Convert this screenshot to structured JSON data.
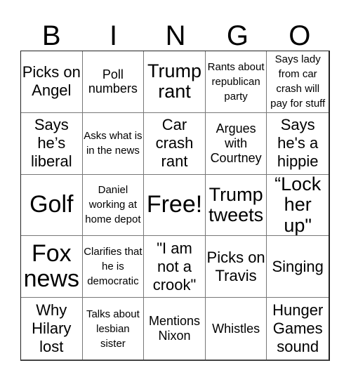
{
  "header": {
    "letters": [
      "B",
      "I",
      "N",
      "G",
      "O"
    ]
  },
  "cells": [
    {
      "text": "Picks on Angel",
      "size": "s-m"
    },
    {
      "text": "Poll numbers",
      "size": "s-s"
    },
    {
      "text": "Trump rant",
      "size": "s-l"
    },
    {
      "text": "Rants about republican party",
      "size": "s-xs"
    },
    {
      "text": "Says lady from car crash will pay for stuff",
      "size": "s-xs"
    },
    {
      "text": "Says he’s liberal",
      "size": "s-m"
    },
    {
      "text": "Asks what is in the news",
      "size": "s-xs"
    },
    {
      "text": "Car crash rant",
      "size": "s-m"
    },
    {
      "text": "Argues with Courtney",
      "size": "s-s"
    },
    {
      "text": "Says he's a hippie",
      "size": "s-m"
    },
    {
      "text": "Golf",
      "size": "s-xl"
    },
    {
      "text": "Daniel working at home depot",
      "size": "s-xs"
    },
    {
      "text": "Free!",
      "size": "s-xl"
    },
    {
      "text": "Trump tweets",
      "size": "s-l"
    },
    {
      "text": "“Lock her up\"",
      "size": "s-l"
    },
    {
      "text": "Fox news",
      "size": "s-xl"
    },
    {
      "text": "Clarifies that he is democratic",
      "size": "s-xs"
    },
    {
      "text": "\"I am not a crook\"",
      "size": "s-m"
    },
    {
      "text": "Picks on Travis",
      "size": "s-m"
    },
    {
      "text": "Singing",
      "size": "s-m"
    },
    {
      "text": "Why Hilary lost",
      "size": "s-m"
    },
    {
      "text": "Talks about lesbian sister",
      "size": "s-xs"
    },
    {
      "text": "Mentions Nixon",
      "size": "s-s"
    },
    {
      "text": "Whistles",
      "size": "s-s"
    },
    {
      "text": "Hunger Games sound",
      "size": "s-m"
    }
  ]
}
